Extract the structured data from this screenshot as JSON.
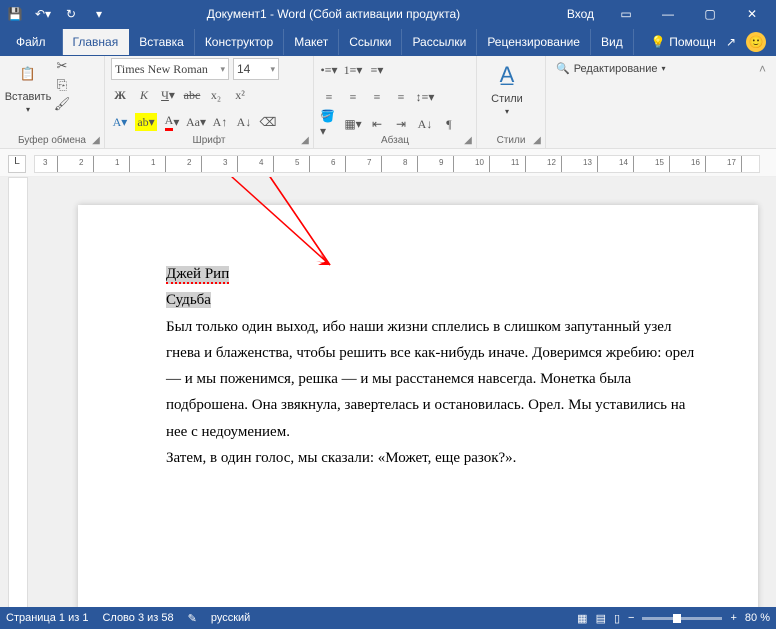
{
  "title": "Документ1  -  Word  (Сбой активации продукта)",
  "login": "Вход",
  "tabs": {
    "file": "Файл",
    "home": "Главная",
    "insert": "Вставка",
    "design": "Конструктор",
    "layout": "Макет",
    "references": "Ссылки",
    "mailings": "Рассылки",
    "review": "Рецензирование",
    "view": "Вид",
    "help": "Помощн"
  },
  "ribbon": {
    "clipboard": {
      "label": "Буфер обмена",
      "paste": "Вставить"
    },
    "font": {
      "label": "Шрифт",
      "name": "Times New Roman",
      "size": "14"
    },
    "paragraph": {
      "label": "Абзац"
    },
    "styles": {
      "label": "Стили",
      "btn": "Стили"
    },
    "editing": {
      "label": "Редактирование"
    }
  },
  "doc": {
    "line1": "Джей Рип",
    "line2": "Судьба",
    "para": "Был только один выход, ибо наши жизни сплелись в слишком запутанный узел гнева и блаженства, чтобы решить все как-нибудь иначе. Доверимся жребию: орел — и мы поженимся, решка — и мы расстанемся навсегда. Монетка была подброшена. Она звякнула, завертелась и остановилась. Орел. Мы уставились на нее с недоумением.",
    "last": "Затем, в один голос, мы сказали: «Может, еще разок?»."
  },
  "status": {
    "page": "Страница 1 из 1",
    "words": "Слово 3 из 58",
    "lang": "русский",
    "zoom": "80 %"
  }
}
